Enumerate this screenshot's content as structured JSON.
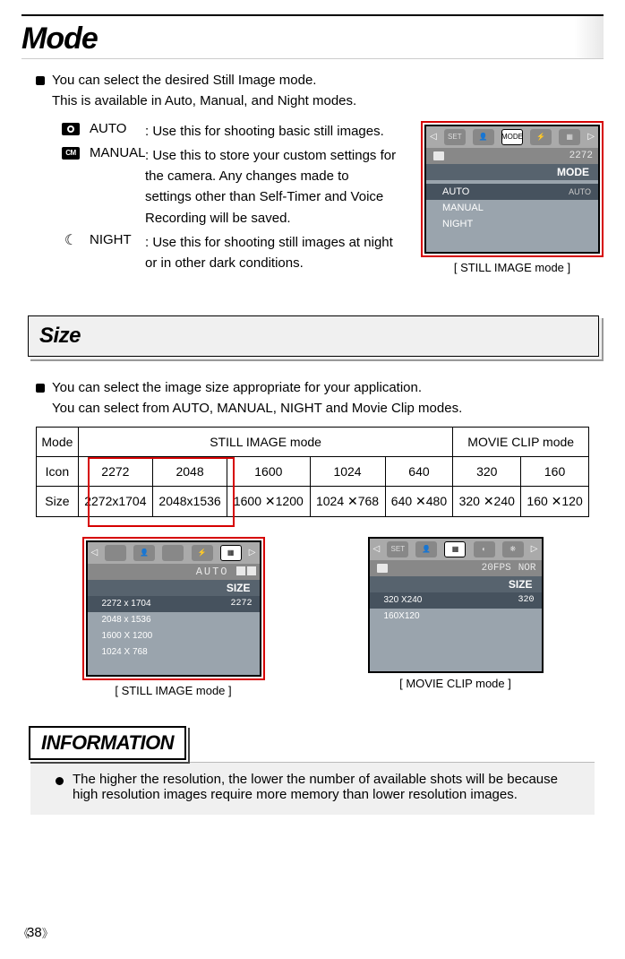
{
  "header": {
    "title": "Mode"
  },
  "intro": {
    "line1": "You can select the desired Still Image mode.",
    "line2": "This is available in Auto, Manual, and Night modes."
  },
  "modes": {
    "auto": {
      "label": "AUTO",
      "desc1": ": Use this for shooting basic still images."
    },
    "manual": {
      "label": "MANUAL",
      "desc1": ": Use this to store your custom settings for",
      "desc2": "the camera. Any changes made to",
      "desc3": "settings other than Self-Timer and Voice",
      "desc4": "Recording will be saved."
    },
    "night": {
      "label": "NIGHT",
      "desc1": ": Use this for shooting still images at night",
      "desc2": "or in other dark conditions."
    }
  },
  "osd_mode": {
    "res_indicator": "2272",
    "section": "MODE",
    "items": {
      "auto": {
        "label": "AUTO",
        "value": "AUTO"
      },
      "manual": {
        "label": "MANUAL"
      },
      "night": {
        "label": "NIGHT"
      }
    },
    "caption": "[ STILL IMAGE mode ]"
  },
  "size_section": {
    "title": "Size",
    "intro1": "You can select the image size appropriate for your application.",
    "intro2": "You can select from AUTO, MANUAL, NIGHT and Movie Clip modes."
  },
  "size_table": {
    "h_mode": "Mode",
    "h_still": "STILL IMAGE mode",
    "h_movie": "MOVIE CLIP mode",
    "h_icon": "Icon",
    "h_size": "Size",
    "icons": {
      "c1": "2272",
      "c2": "2048",
      "c3": "1600",
      "c4": "1024",
      "c5": "640",
      "c6": "320",
      "c7": "160"
    },
    "sizes": {
      "c1": "2272x1704",
      "c2": "2048x1536",
      "c3": "1600 ✕1200",
      "c4": "1024 ✕768",
      "c5": "640 ✕480",
      "c6": "320 ✕240",
      "c7": "160 ✕120"
    }
  },
  "osd_size_still": {
    "auto_label": "AUTO",
    "section": "SIZE",
    "items": {
      "r1": {
        "label": "2272 x 1704",
        "value": "2272"
      },
      "r2": {
        "label": "2048 x 1536"
      },
      "r3": {
        "label": "1600 X 1200"
      },
      "r4": {
        "label": "1024 X 768"
      }
    },
    "caption": "[ STILL IMAGE mode ]"
  },
  "osd_size_movie": {
    "fps_label": "20FPS",
    "nor_label": "NOR",
    "section": "SIZE",
    "items": {
      "r1": {
        "label": "320 X240",
        "value": "320"
      },
      "r2": {
        "label": "160X120"
      }
    },
    "caption": "[ MOVIE CLIP mode ]"
  },
  "info": {
    "title": "INFORMATION",
    "body": "The higher the resolution, the lower the number of available shots will be because high resolution images require more memory than lower resolution images."
  },
  "page_number": "38",
  "cm_text": "CM",
  "chart_data": {
    "type": "table",
    "title": "Size",
    "columns_group": [
      "STILL IMAGE mode",
      "STILL IMAGE mode",
      "STILL IMAGE mode",
      "STILL IMAGE mode",
      "STILL IMAGE mode",
      "MOVIE CLIP mode",
      "MOVIE CLIP mode"
    ],
    "rows": [
      {
        "name": "Icon",
        "values": [
          "2272",
          "2048",
          "1600",
          "1024",
          "640",
          "320",
          "160"
        ]
      },
      {
        "name": "Size",
        "values": [
          "2272x1704",
          "2048x1536",
          "1600x1200",
          "1024x768",
          "640x480",
          "320x240",
          "160x120"
        ]
      }
    ]
  }
}
